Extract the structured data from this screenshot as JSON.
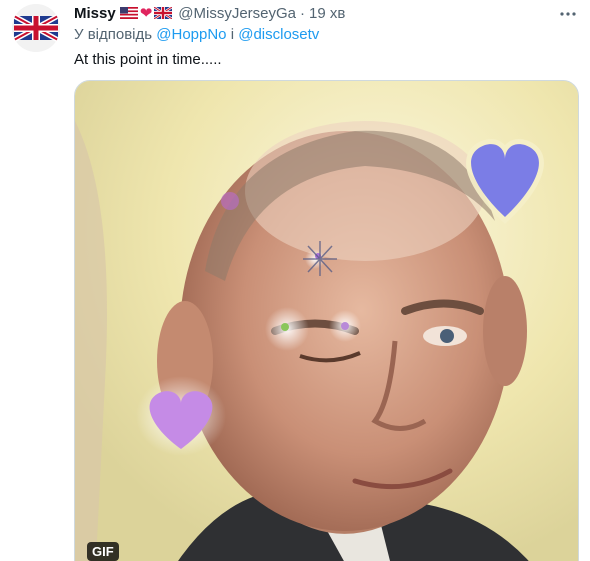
{
  "tweet": {
    "display_name": "Missy",
    "handle": "@MissyJerseyGa",
    "separator": "·",
    "time": "19 хв",
    "reply_prefix": "У відповідь",
    "reply_mention_1": "@HoppNo",
    "reply_conjunction": "і",
    "reply_mention_2": "@disclosetv",
    "text": "At this point in time.....",
    "media_badge": "GIF"
  },
  "icons": {
    "avatar": "uk-flag-avatar",
    "flags": [
      "us-flag-icon",
      "red-heart-icon",
      "uk-flag-icon"
    ],
    "more": "more-options-icon"
  },
  "colors": {
    "accent": "#1d9bf0",
    "muted": "#536471",
    "heart": "#e0245e",
    "purple_heart": "#7b7de6",
    "lilac_heart": "#c58be6"
  }
}
